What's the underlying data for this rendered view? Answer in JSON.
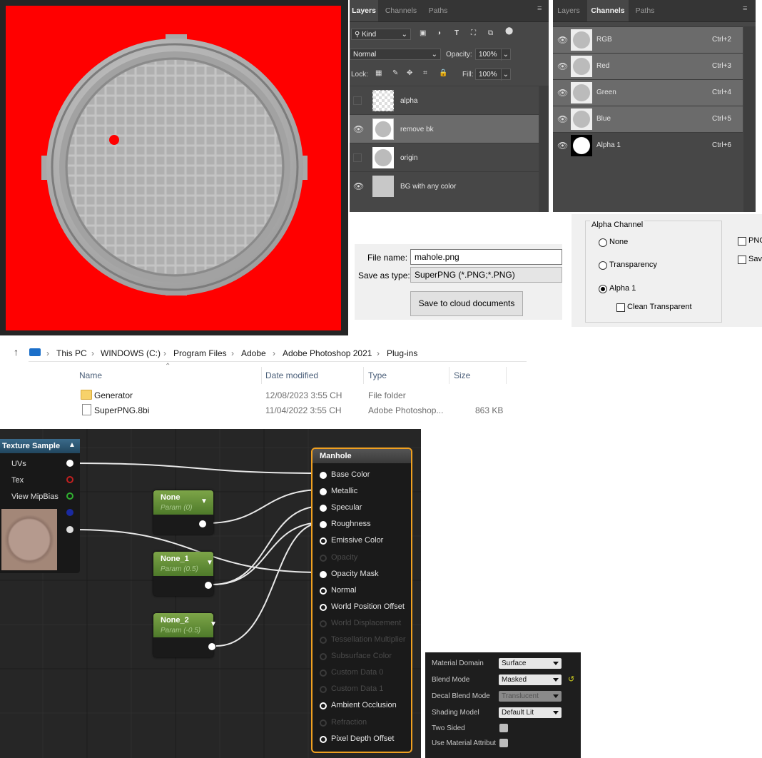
{
  "layers_panel": {
    "tabs": [
      "Layers",
      "Channels",
      "Paths"
    ],
    "kind_label": "Kind",
    "blend_mode": "Normal",
    "opacity_label": "Opacity:",
    "opacity_value": "100%",
    "lock_label": "Lock:",
    "fill_label": "Fill:",
    "fill_value": "100%",
    "layers": [
      {
        "name": "alpha",
        "visible": false
      },
      {
        "name": "remove bk",
        "visible": true
      },
      {
        "name": "origin",
        "visible": false
      },
      {
        "name": "BG with any color",
        "visible": true
      }
    ]
  },
  "channels_panel": {
    "tabs": [
      "Layers",
      "Channels",
      "Paths"
    ],
    "channels": [
      {
        "name": "RGB",
        "shortcut": "Ctrl+2"
      },
      {
        "name": "Red",
        "shortcut": "Ctrl+3"
      },
      {
        "name": "Green",
        "shortcut": "Ctrl+4"
      },
      {
        "name": "Blue",
        "shortcut": "Ctrl+5"
      },
      {
        "name": "Alpha 1",
        "shortcut": "Ctrl+6"
      }
    ]
  },
  "save_dialog": {
    "file_name_label": "File name:",
    "file_name_value": "mahole.png",
    "save_type_label": "Save as type:",
    "save_type_value": "SuperPNG (*.PNG;*.PNG)",
    "cloud_button": "Save to cloud documents"
  },
  "alpha_dialog": {
    "group_title": "Alpha Channel",
    "options": [
      "None",
      "Transparency",
      "Alpha 1"
    ],
    "selected_index": 2,
    "clean_label": "Clean Transparent",
    "side_checks": [
      "PNG",
      "Sav"
    ]
  },
  "explorer": {
    "path": [
      "This PC",
      "WINDOWS (C:)",
      "Program Files",
      "Adobe",
      "Adobe Photoshop 2021",
      "Plug-ins"
    ],
    "columns": [
      "Name",
      "Date modified",
      "Type",
      "Size"
    ],
    "rows": [
      {
        "name": "Generator",
        "date": "12/08/2023 3:55 CH",
        "type": "File folder",
        "size": ""
      },
      {
        "name": "SuperPNG.8bi",
        "date": "11/04/2022 3:55 CH",
        "type": "Adobe Photoshop...",
        "size": "863 KB"
      }
    ]
  },
  "material_graph": {
    "texture_node": {
      "title": "Texture Sample",
      "pins": [
        "UVs",
        "Tex",
        "View MipBias"
      ]
    },
    "params": [
      {
        "title": "None",
        "sub": "Param (0)"
      },
      {
        "title": "None_1",
        "sub": "Param (0.5)"
      },
      {
        "title": "None_2",
        "sub": "Param (-0.5)"
      }
    ],
    "result_node": {
      "title": "Manhole",
      "pins": [
        {
          "label": "Base Color",
          "active": true,
          "filled": true
        },
        {
          "label": "Metallic",
          "active": true,
          "filled": true
        },
        {
          "label": "Specular",
          "active": true,
          "filled": true
        },
        {
          "label": "Roughness",
          "active": true,
          "filled": true
        },
        {
          "label": "Emissive Color",
          "active": true,
          "filled": false
        },
        {
          "label": "Opacity",
          "active": false,
          "filled": false
        },
        {
          "label": "Opacity Mask",
          "active": true,
          "filled": true
        },
        {
          "label": "Normal",
          "active": true,
          "filled": false
        },
        {
          "label": "World Position Offset",
          "active": true,
          "filled": false
        },
        {
          "label": "World Displacement",
          "active": false,
          "filled": false
        },
        {
          "label": "Tessellation Multiplier",
          "active": false,
          "filled": false
        },
        {
          "label": "Subsurface Color",
          "active": false,
          "filled": false
        },
        {
          "label": "Custom Data 0",
          "active": false,
          "filled": false
        },
        {
          "label": "Custom Data 1",
          "active": false,
          "filled": false
        },
        {
          "label": "Ambient Occlusion",
          "active": true,
          "filled": false
        },
        {
          "label": "Refraction",
          "active": false,
          "filled": false
        },
        {
          "label": "Pixel Depth Offset",
          "active": true,
          "filled": false
        }
      ]
    }
  },
  "material_details": {
    "rows": [
      {
        "label": "Material Domain",
        "value": "Surface",
        "kind": "combo",
        "enabled": true
      },
      {
        "label": "Blend Mode",
        "value": "Masked",
        "kind": "combo",
        "enabled": true
      },
      {
        "label": "Decal Blend Mode",
        "value": "Translucent",
        "kind": "combo",
        "enabled": false
      },
      {
        "label": "Shading Model",
        "value": "Default Lit",
        "kind": "combo",
        "enabled": true
      },
      {
        "label": "Two Sided",
        "value": "",
        "kind": "checkbox",
        "enabled": true
      },
      {
        "label": "Use Material Attribut",
        "value": "",
        "kind": "checkbox",
        "enabled": true
      }
    ]
  },
  "colors": {
    "canvas_bg": "#ff0000",
    "node_border": "#f0a020",
    "param_header": "#6b9a3a"
  }
}
